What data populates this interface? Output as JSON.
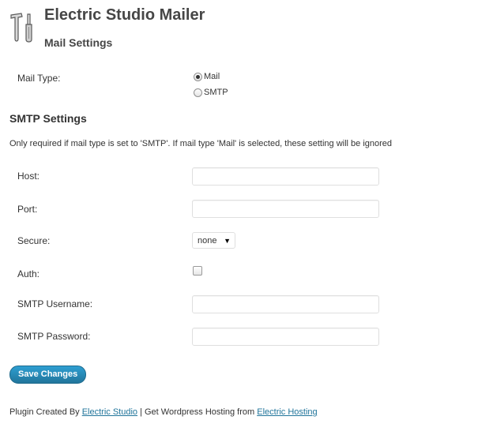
{
  "header": {
    "icon": "tools-icon",
    "title": "Electric Studio Mailer",
    "subtitle": "Mail Settings"
  },
  "mail_type": {
    "label": "Mail Type:",
    "options": [
      {
        "label": "Mail",
        "checked": true
      },
      {
        "label": "SMTP",
        "checked": false
      }
    ]
  },
  "smtp": {
    "heading": "SMTP Settings",
    "note": "Only required if mail type is set to 'SMTP'. If mail type 'Mail' is selected, these setting will be ignored",
    "host_label": "Host:",
    "host_value": "",
    "port_label": "Port:",
    "port_value": "",
    "secure_label": "Secure:",
    "secure_value": "none",
    "auth_label": "Auth:",
    "auth_checked": false,
    "username_label": "SMTP Username:",
    "username_value": "",
    "password_label": "SMTP Password:",
    "password_value": ""
  },
  "actions": {
    "save_label": "Save Changes",
    "button_color": "#21759b"
  },
  "footer": {
    "prefix": "Plugin Created By ",
    "link1": "Electric Studio",
    "middle": " | Get Wordpress Hosting from ",
    "link2": "Electric Hosting",
    "link_color": "#21759b"
  }
}
